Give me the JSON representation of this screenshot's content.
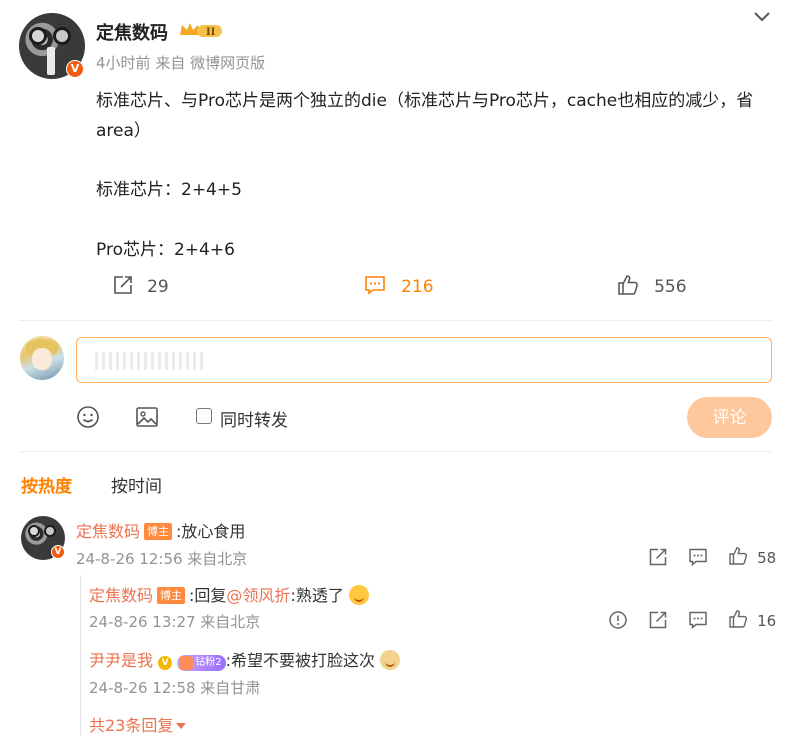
{
  "post": {
    "author": "定焦数码",
    "time": "4小时前",
    "source_prefix": "来自",
    "source": "微博网页版",
    "lines": [
      "标准芯片、与Pro芯片是两个独立的die（标准芯片与Pro芯片，cache也相应的减少，省area）",
      "标准芯片：2+4+5",
      "Pro芯片：2+4+6"
    ],
    "actions": {
      "repost_count": "29",
      "comment_count": "216",
      "like_count": "556"
    }
  },
  "composer": {
    "repost_label": "同时转发",
    "submit_label": "评论"
  },
  "sort_tabs": {
    "hot": "按热度",
    "time": "按时间"
  },
  "comments": [
    {
      "user": "定焦数码",
      "badge": "博主",
      "text": ":放心食用",
      "meta": "24-8-26 12:56 来自北京",
      "like_count": "58"
    }
  ],
  "replies": [
    {
      "user": "定焦数码",
      "badge": "博主",
      "reply_prefix": ":回复",
      "mention": "@领风折",
      "text": ":熟透了",
      "meta": "24-8-26 13:27 来自北京",
      "like_count": "16"
    },
    {
      "user": "尹尹是我",
      "vip": "钻粉2",
      "text": ":希望不要被打脸这次",
      "meta": "24-8-26 12:58 来自甘肃"
    }
  ],
  "more_replies": "共23条回复",
  "colors": {
    "accent": "#ff8200",
    "username": "#eb7350",
    "submit_disabled": "#ffc79c",
    "input_border": "#ffb15c"
  }
}
